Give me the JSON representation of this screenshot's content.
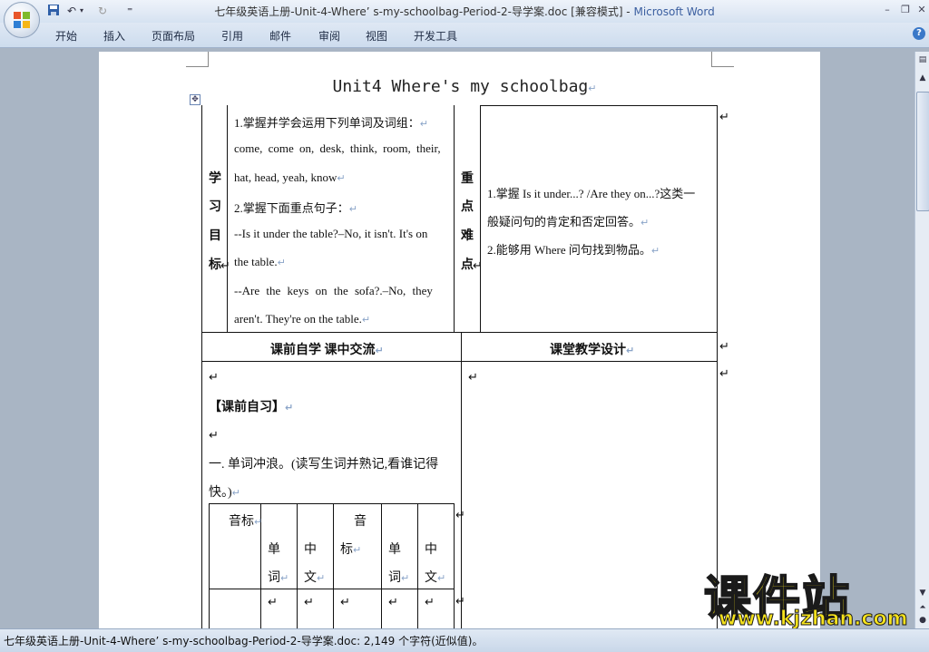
{
  "window": {
    "title": "七年级英语上册-Unit-4-Where’ s-my-schoolbag-Period-2-导学案.doc [兼容模式] - ",
    "app_name": "Microsoft Word"
  },
  "qat": {
    "undo": "↶",
    "redo": "↻",
    "dropdown": "⁼"
  },
  "winctl": {
    "minimize": "–",
    "restore": "❐",
    "close": "✕"
  },
  "menu": [
    "开始",
    "插入",
    "页面布局",
    "引用",
    "邮件",
    "审阅",
    "视图",
    "开发工具"
  ],
  "help": "?",
  "doc": {
    "title": "Unit4 Where's my schoolbag",
    "pm": "↵",
    "goals_header": [
      "学",
      "习",
      "目",
      "标"
    ],
    "goals": [
      "1.掌握并学会运用下列单词及词组：",
      "come, come on, desk, think, room, their,",
      "hat, head, yeah, know",
      "2.掌握下面重点句子：",
      "--Is it under the table?–No, it isn't. It's on",
      "the table.",
      "--Are the keys on the sofa?.–No, they",
      "aren't. They're on the table."
    ],
    "diff_header": [
      "重",
      "点",
      "难",
      "点"
    ],
    "difficulties": [
      "1.掌握 Is it under...? /Are they on...?这类一",
      "般疑问句的肯定和否定回答。",
      "2.能够用 Where 问句找到物品。"
    ],
    "left_section_header": "课前自学   课中交流",
    "right_section_header": "课堂教学设计",
    "self_study_title": "【课前自习】",
    "exercise1_line1": "一. 单词冲浪。(读写生词并熟记,看谁记得",
    "exercise1_line2": "快。)",
    "vocab_headers": {
      "phonetic1": "音标",
      "word1a": "单",
      "word1b": "词",
      "cn1a": "中",
      "cn1b": "文",
      "phonetic2a": "音",
      "phonetic2b": "标",
      "word2a": "单",
      "word2b": "词",
      "cn2a": "中",
      "cn2b": "文"
    }
  },
  "status": "七年级英语上册-Unit-4-Where’ s-my-schoolbag-Period-2-导学案.doc: 2,149 个字符(近似值)。",
  "watermark": {
    "cn": "课件站",
    "url": "www.kjzhan.com"
  }
}
